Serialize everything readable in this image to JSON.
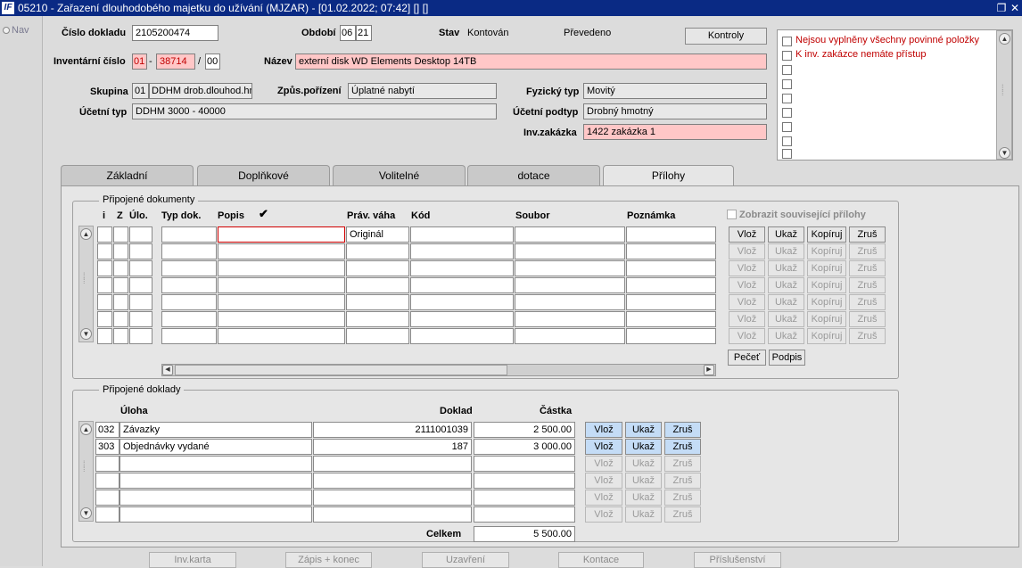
{
  "window": {
    "title": "05210 - Zařazení dlouhodobého majetku do užívání (MJZAR) - [01.02.2022; 07:42]  [] []",
    "logo": "IF"
  },
  "nav": {
    "label": "Nav"
  },
  "header": {
    "cislo_dokladu_label": "Číslo dokladu",
    "cislo_dokladu": "2105200474",
    "obdobi_label": "Období",
    "obdobi_month": "06",
    "obdobi_year": "21",
    "stav_label": "Stav",
    "stav_value": "Kontován",
    "prevedeno": "Převedeno",
    "kontroly_button": "Kontroly",
    "inv_cislo_label": "Inventární číslo",
    "inv_cislo_1": "01",
    "inv_cislo_sep": "-",
    "inv_cislo_2": "38714",
    "inv_cislo_slash": "/",
    "inv_cislo_3": "00",
    "nazev_label": "Název",
    "nazev": "externí disk WD Elements Desktop 14TB",
    "skupina_label": "Skupina",
    "skupina_code": "01",
    "skupina_name": "DDHM drob.dlouhod.hm",
    "zpusob_label": "Způs.pořízení",
    "zpusob_value": "Úplatné nabytí",
    "fyzicky_typ_label": "Fyzický typ",
    "fyzicky_typ_value": "Movitý",
    "ucetni_typ_label": "Účetní typ",
    "ucetni_typ_value": "DDHM 3000 - 40000",
    "ucetni_podtyp_label": "Účetní podtyp",
    "ucetni_podtyp_value": "Drobný hmotný",
    "inv_zakazka_label": "Inv.zakázka",
    "inv_zakazka_value": "1422 zakázka 1"
  },
  "validation": {
    "messages": [
      "Nejsou vyplněny všechny povinné položky",
      "K inv. zakázce nemáte přístup"
    ]
  },
  "tabs": [
    "Základní",
    "Doplňkové",
    "Volitelné",
    "dotace",
    "Přílohy"
  ],
  "active_tab": "Přílohy",
  "dokumenty": {
    "group_title": "Připojené dokumenty",
    "columns": {
      "i": "i",
      "z": "Z",
      "ulo": "Úlo.",
      "typ": "Typ dok.",
      "popis": "Popis",
      "prav": "Práv. váha",
      "kod": "Kód",
      "soubor": "Soubor",
      "poznamka": "Poznámka"
    },
    "checkmark": "✔",
    "zobrazit_label": "Zobrazit související přílohy",
    "first_row_prav": "Originál",
    "row_buttons": {
      "vloz": "Vlož",
      "ukaz": "Ukaž",
      "kopiruj": "Kopíruj",
      "zrus": "Zruš"
    },
    "pecet_button": "Pečeť",
    "podpis_button": "Podpis"
  },
  "doklady": {
    "group_title": "Připojené doklady",
    "columns": {
      "uloha": "Úloha",
      "doklad": "Doklad",
      "castka": "Částka"
    },
    "rows": [
      {
        "code": "032",
        "uloha": "Závazky",
        "doklad": "2111001039",
        "castka": "2 500.00"
      },
      {
        "code": "303",
        "uloha": "Objednávky vydané",
        "doklad": "187",
        "castka": "3 000.00"
      }
    ],
    "celkem_label": "Celkem",
    "celkem_value": "5 500.00",
    "row_buttons": {
      "vloz": "Vlož",
      "ukaz": "Ukaž",
      "zrus": "Zruš"
    }
  },
  "footer_buttons": [
    "Inv.karta",
    "Zápis + konec",
    "Uzavření",
    "Kontace",
    "Příslušenství"
  ]
}
